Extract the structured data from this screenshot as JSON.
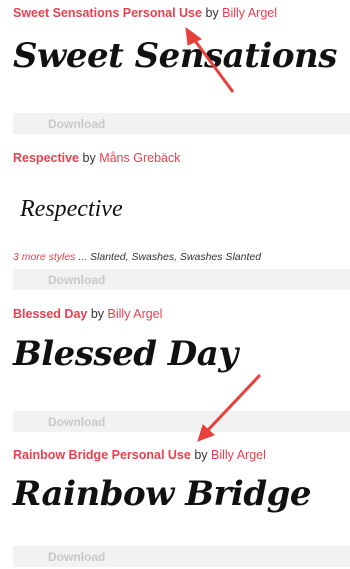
{
  "fonts": [
    {
      "name": "Sweet Sensations Personal Use",
      "by": "by",
      "author": "Billy Argel",
      "preview_text": "Sweet Sensations",
      "download_label": "Download"
    },
    {
      "name": "Respective",
      "by": "by",
      "author": "Måns Grebäck",
      "preview_text": "Respective",
      "more_styles_link": "3 more styles",
      "more_styles_list": "... Slanted, Swashes, Swashes Slanted",
      "download_label": "Download"
    },
    {
      "name": "Blessed Day",
      "by": "by",
      "author": "Billy Argel",
      "preview_text": "Blessed Day",
      "download_label": "Download"
    },
    {
      "name": "Rainbow Bridge Personal Use",
      "by": "by",
      "author": "Billy Argel",
      "preview_text": "Rainbow Bridge",
      "download_label": "Download"
    }
  ],
  "colors": {
    "accent": "#e8414f",
    "download_bg": "#f2f2f2",
    "download_text": "#c8c8c8",
    "annotation_arrow": "#e8403a"
  }
}
